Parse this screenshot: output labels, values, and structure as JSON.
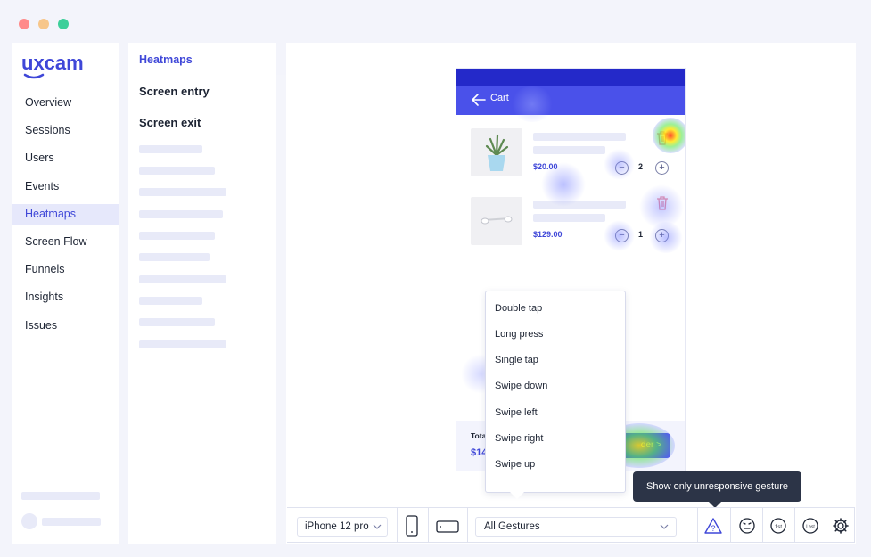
{
  "window": {
    "controls": [
      {
        "name": "close",
        "color": "#ff8a8a"
      },
      {
        "name": "minimize",
        "color": "#f7c68a"
      },
      {
        "name": "maximize",
        "color": "#3dcf9a"
      }
    ]
  },
  "brand": {
    "logo_text": "uxcam",
    "color": "#3f47d8"
  },
  "sidebar": {
    "items": [
      {
        "label": "Overview",
        "active": false
      },
      {
        "label": "Sessions",
        "active": false
      },
      {
        "label": "Users",
        "active": false
      },
      {
        "label": "Events",
        "active": false
      },
      {
        "label": "Heatmaps",
        "active": true
      },
      {
        "label": "Screen Flow",
        "active": false
      },
      {
        "label": "Funnels",
        "active": false
      },
      {
        "label": "Insights",
        "active": false
      },
      {
        "label": "Issues",
        "active": false
      }
    ]
  },
  "panel": {
    "title": "Heatmaps",
    "links": [
      "Screen entry",
      "Screen exit"
    ]
  },
  "phone": {
    "header_title": "Cart",
    "products": [
      {
        "price": "$20.00",
        "qty": "2",
        "image": "plant-icon",
        "action": "trash-icon"
      },
      {
        "price": "$129.00",
        "qty": "1",
        "image": "earbuds-icon",
        "action": "trash-icon"
      }
    ],
    "stepper": {
      "minus": "−",
      "plus": "+"
    },
    "footer": {
      "total_label": "Tota",
      "total_value": "$14",
      "order_label": "der >"
    }
  },
  "gesture_menu": {
    "options": [
      "Double tap",
      "Long press",
      "Single tap",
      "Swipe down",
      "Swipe left",
      "Swipe right",
      "Swipe up"
    ]
  },
  "tooltip": {
    "text": "Show only unresponsive gesture"
  },
  "toolbar": {
    "device": "iPhone 12 pro",
    "gesture_filter": "All Gestures",
    "orientation_icons": [
      "portrait-icon",
      "landscape-icon"
    ],
    "action_icons": [
      "unresponsive-warning-icon",
      "rage-gesture-icon",
      "first-gesture-icon",
      "last-gesture-icon",
      "settings-gear-icon"
    ]
  },
  "colors": {
    "accent": "#3f47d8",
    "header_blue": "#4a51ea",
    "status_blue": "#2429c9",
    "tooltip_bg": "#2c3447"
  }
}
